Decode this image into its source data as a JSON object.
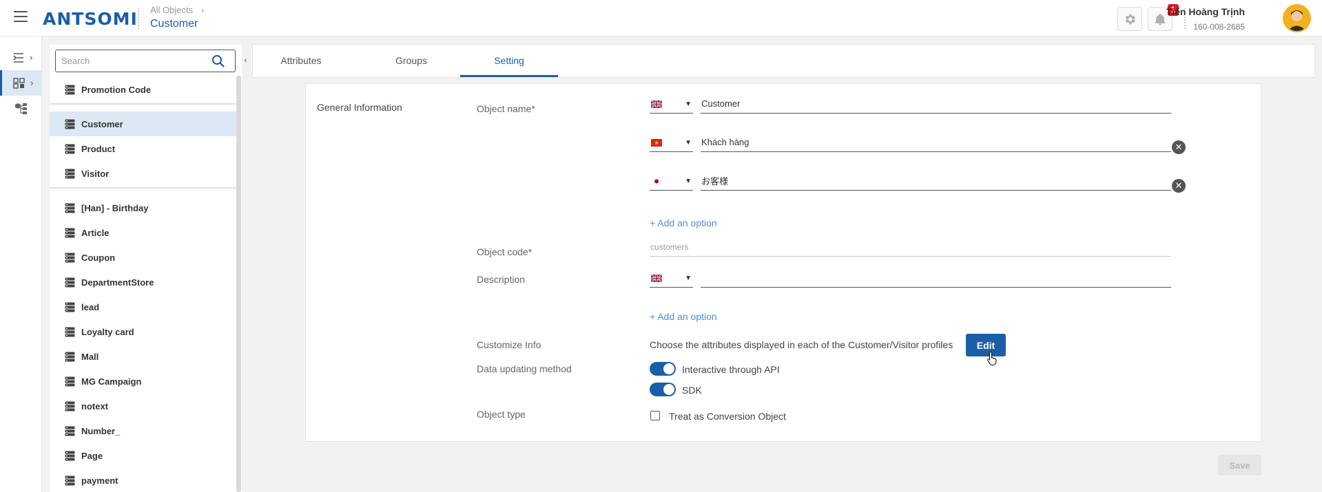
{
  "header": {
    "logo_text": "ANTSOMI",
    "breadcrumb_parent": "All Objects",
    "page_title": "Customer",
    "notification_count": "1",
    "user_name": "Tiến Hoàng Trịnh",
    "user_id": "160-008-2685",
    "colors": {
      "brand": "#1a5ea8",
      "badge": "#e0161c"
    }
  },
  "sidebar_rail": {
    "items": [
      {
        "icon": "import-icon"
      },
      {
        "icon": "data-objects-icon",
        "active": true
      },
      {
        "icon": "object-relation-icon"
      }
    ]
  },
  "object_list": {
    "search_placeholder": "Search",
    "items": [
      {
        "label": "Promotion Code"
      },
      {
        "label": "Customer",
        "active": true
      },
      {
        "label": "Product"
      },
      {
        "label": "Visitor"
      },
      {
        "label": "[Han] - Birthday"
      },
      {
        "label": "Article"
      },
      {
        "label": "Coupon"
      },
      {
        "label": "DepartmentStore"
      },
      {
        "label": "lead"
      },
      {
        "label": "Loyalty card"
      },
      {
        "label": "Mall"
      },
      {
        "label": "MG Campaign"
      },
      {
        "label": "notext"
      },
      {
        "label": "Number_"
      },
      {
        "label": "Page"
      },
      {
        "label": "payment"
      }
    ]
  },
  "tabs": [
    {
      "label": "Attributes"
    },
    {
      "label": "Groups"
    },
    {
      "label": "Setting",
      "active": true
    }
  ],
  "settings": {
    "section_title": "General Information",
    "object_name_label": "Object name*",
    "object_names": [
      {
        "lang": "uk-flag",
        "value": "Customer"
      },
      {
        "lang": "vn-flag",
        "value": "Khách hàng"
      },
      {
        "lang": "jp-flag",
        "value": "お客様"
      }
    ],
    "add_option_label": "+ Add an option",
    "object_code_label": "Object code*",
    "object_code_value": "customers",
    "description_label": "Description",
    "description_lang": "uk-flag",
    "description_value": "",
    "add_option_label_2": "+ Add an option",
    "customize_info_label": "Customize Info",
    "customize_info_text": "Choose the attributes displayed in each of the Customer/Visitor profiles",
    "edit_label": "Edit",
    "data_updating_label": "Data updating method",
    "methods": [
      {
        "label": "Interactive through API",
        "enabled": true
      },
      {
        "label": "SDK",
        "enabled": true
      }
    ],
    "object_type_label": "Object type",
    "conversion_label": "Treat as Conversion Object",
    "conversion_checked": false
  },
  "footer": {
    "save_label": "Save"
  }
}
